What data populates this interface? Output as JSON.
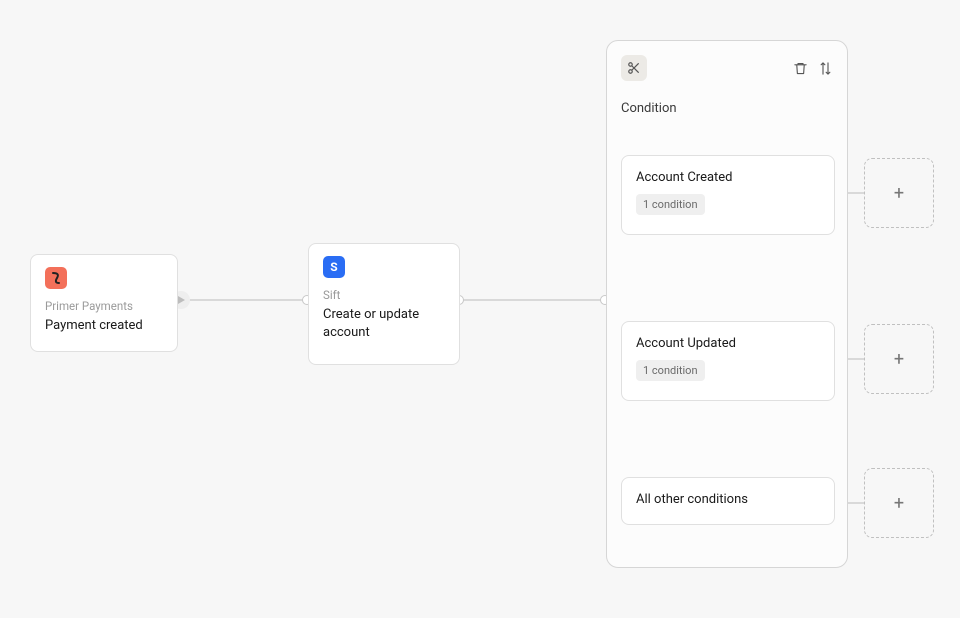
{
  "trigger": {
    "provider": "Primer Payments",
    "event": "Payment created"
  },
  "action": {
    "provider": "Sift",
    "name": "Create or update account"
  },
  "condition": {
    "title": "Condition",
    "branches": [
      {
        "label": "Account Created",
        "rule_count_text": "1 condition"
      },
      {
        "label": "Account Updated",
        "rule_count_text": "1 condition"
      },
      {
        "label": "All other conditions"
      }
    ]
  },
  "icons": {
    "scissors": "scissors-icon",
    "trash": "trash-icon",
    "reorder": "reorder-icon",
    "plus": "+"
  }
}
